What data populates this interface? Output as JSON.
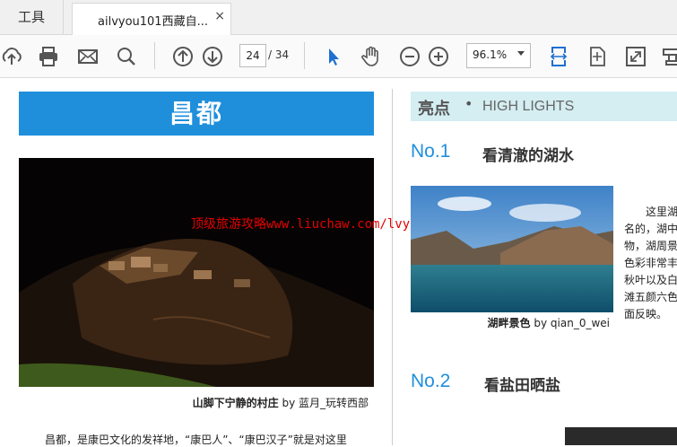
{
  "tabs": {
    "tools_label": "工具",
    "doc_title": "ailvyou101西藏自...",
    "close_glyph": "×"
  },
  "toolbar": {
    "current_page": "24",
    "page_total": "/ 34",
    "zoom": "96.1%",
    "icons": [
      "upload-icon",
      "print-icon",
      "mail-icon",
      "search-icon",
      "page-up-icon",
      "page-down-icon",
      "select-arrow-icon",
      "hand-icon",
      "zoom-out-icon",
      "zoom-in-icon",
      "fit-width-icon",
      "fit-page-icon",
      "fullscreen-icon",
      "stamp-icon"
    ],
    "accent": "#1f6fd0"
  },
  "document": {
    "title": "昌都",
    "title_color": "#1f8fdc",
    "caption_main_bold": "山脚下宁静的村庄",
    "caption_main_rest": " by 蓝月_玩转西部",
    "body_line": "昌都，是康巴文化的发祥地，“康巴人”、“康巴汉子”就是对这里",
    "watermark": "顶级旅游攻略www.liuchaw.com/lvyou/ailvyou",
    "highlights_title": "亮点",
    "highlights_dot": "•",
    "highlights_sub": "HIGH LIGHTS",
    "no1_num": "No.1",
    "no1_title": "看清澈的湖水",
    "caption_lake_bold": "湖畔景色",
    "caption_lake_rest": " by qian_0_wei",
    "lake_text": "　　这里湖\n名的，湖中\n物，湖周景\n色彩非常丰\n秋叶以及白\n滩五颜六色\n面反映。",
    "no2_num": "No.2",
    "no2_title": "看盐田晒盐"
  }
}
